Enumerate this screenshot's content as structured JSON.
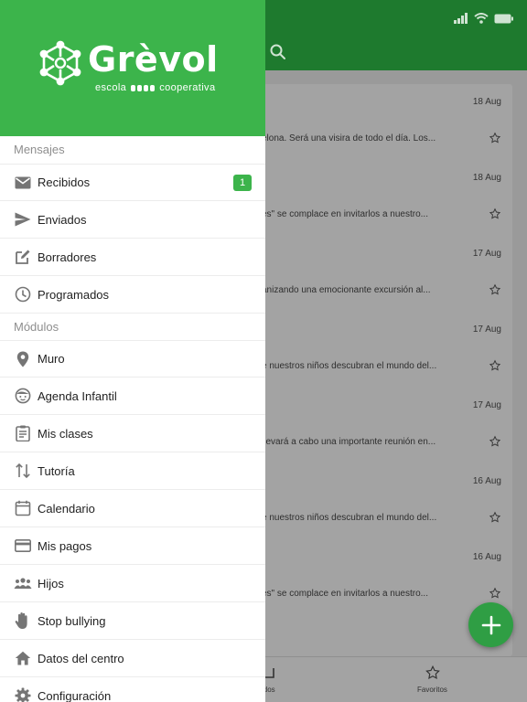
{
  "colors": {
    "brand_green": "#3cb44b",
    "badge_green": "#3cb44b",
    "fab_green": "#2f9e44",
    "overlay_gray": "#9a9a9a"
  },
  "drawer": {
    "logo": {
      "name": "Grèvol",
      "subtitle_left": "escola",
      "subtitle_right": "cooperativa"
    },
    "sections": [
      {
        "label": "Mensajes",
        "items": [
          {
            "label": "Recibidos",
            "icon": "mail-icon",
            "badge": "1"
          },
          {
            "label": "Enviados",
            "icon": "send-icon"
          },
          {
            "label": "Borradores",
            "icon": "edit-icon"
          },
          {
            "label": "Programados",
            "icon": "clock-icon"
          }
        ]
      },
      {
        "label": "Módulos",
        "items": [
          {
            "label": "Muro",
            "icon": "location-pin-icon"
          },
          {
            "label": "Agenda Infantil",
            "icon": "child-face-icon"
          },
          {
            "label": "Mis clases",
            "icon": "clipboard-icon"
          },
          {
            "label": "Tutoría",
            "icon": "swap-vertical-icon"
          },
          {
            "label": "Calendario",
            "icon": "calendar-icon"
          },
          {
            "label": "Mis pagos",
            "icon": "credit-card-icon"
          },
          {
            "label": "Hijos",
            "icon": "people-icon"
          },
          {
            "label": "Stop  bullying",
            "icon": "hand-icon"
          },
          {
            "label": "Datos del centro",
            "icon": "home-icon"
          },
          {
            "label": "Configuración",
            "icon": "gear-icon"
          }
        ]
      }
    ]
  },
  "background": {
    "messages": [
      {
        "date": "18 Aug",
        "snippet": "elona. Será una visira de todo el día. Los..."
      },
      {
        "date": "18 Aug",
        "snippet": "es\" se complace en invitarlos a nuestro..."
      },
      {
        "date": "17 Aug",
        "snippet": "anizando una emocionante excursión al..."
      },
      {
        "date": "17 Aug",
        "snippet": "e nuestros niños descubran el mundo del..."
      },
      {
        "date": "17 Aug",
        "snippet": "llevará a cabo una importante reunión en..."
      },
      {
        "date": "16 Aug",
        "snippet": "e nuestros niños descubran el mundo del..."
      },
      {
        "date": "16 Aug",
        "snippet": "es\" se complace en invitarlos a nuestro..."
      }
    ],
    "bottom_tabs": [
      {
        "label": "idos",
        "icon": "inbox-icon"
      },
      {
        "label": "Favoritos",
        "icon": "star-icon"
      }
    ]
  }
}
